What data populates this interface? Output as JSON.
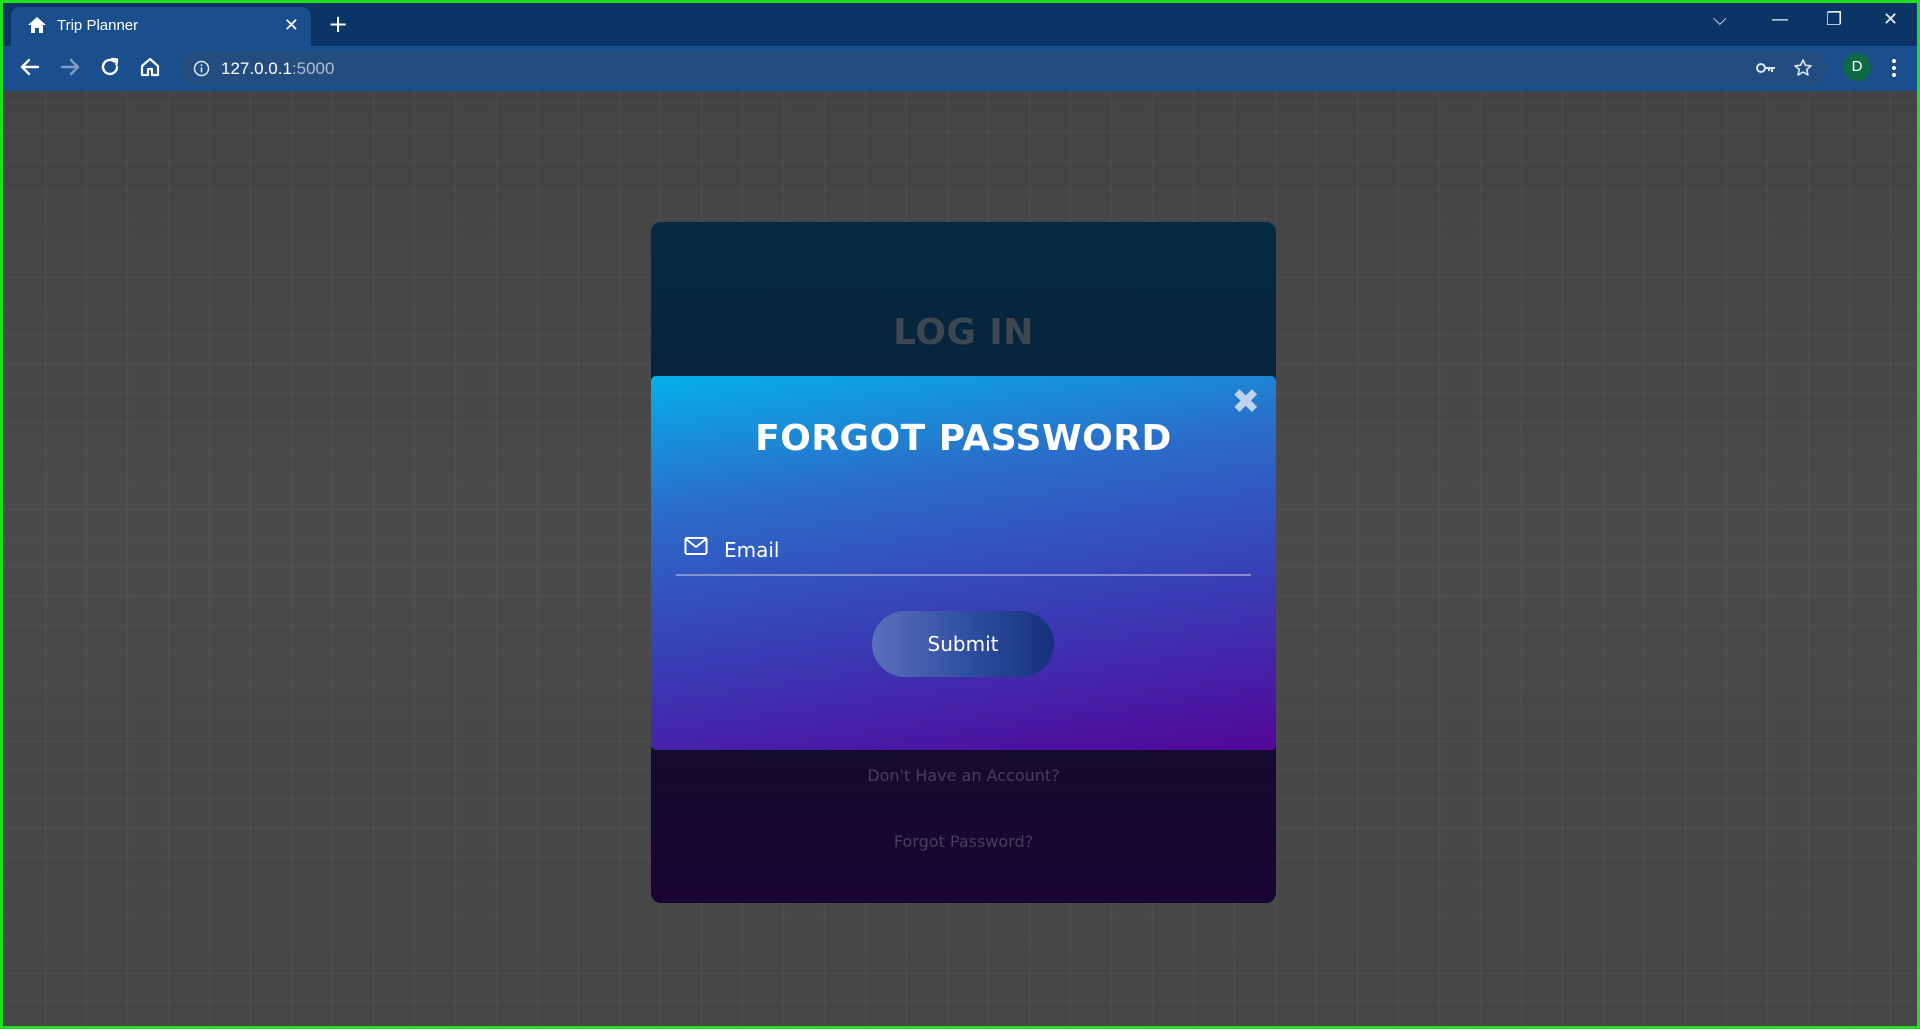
{
  "browser": {
    "tab_title": "Trip Planner",
    "tab_close": "✕",
    "new_tab": "+",
    "url_host": "127.0.0.1",
    "url_port": ":5000",
    "profile_initial": "D",
    "window_controls": {
      "tab_search": "⌵",
      "minimize": "—",
      "restore": "❐",
      "close": "✕"
    }
  },
  "login_card": {
    "title": "LOG IN",
    "signup_link": "Don't Have an Account?",
    "forgot_link": "Forgot Password?"
  },
  "forgot_modal": {
    "close_label": "✖",
    "title": "FORGOT PASSWORD",
    "email_placeholder": "Email",
    "email_value": "",
    "submit_label": "Submit"
  },
  "colors": {
    "browser_frame": "#0b3566",
    "toolbar": "#1a4e8c",
    "modal_gradient_start": "#05b0e8",
    "modal_gradient_end": "#52069a"
  }
}
